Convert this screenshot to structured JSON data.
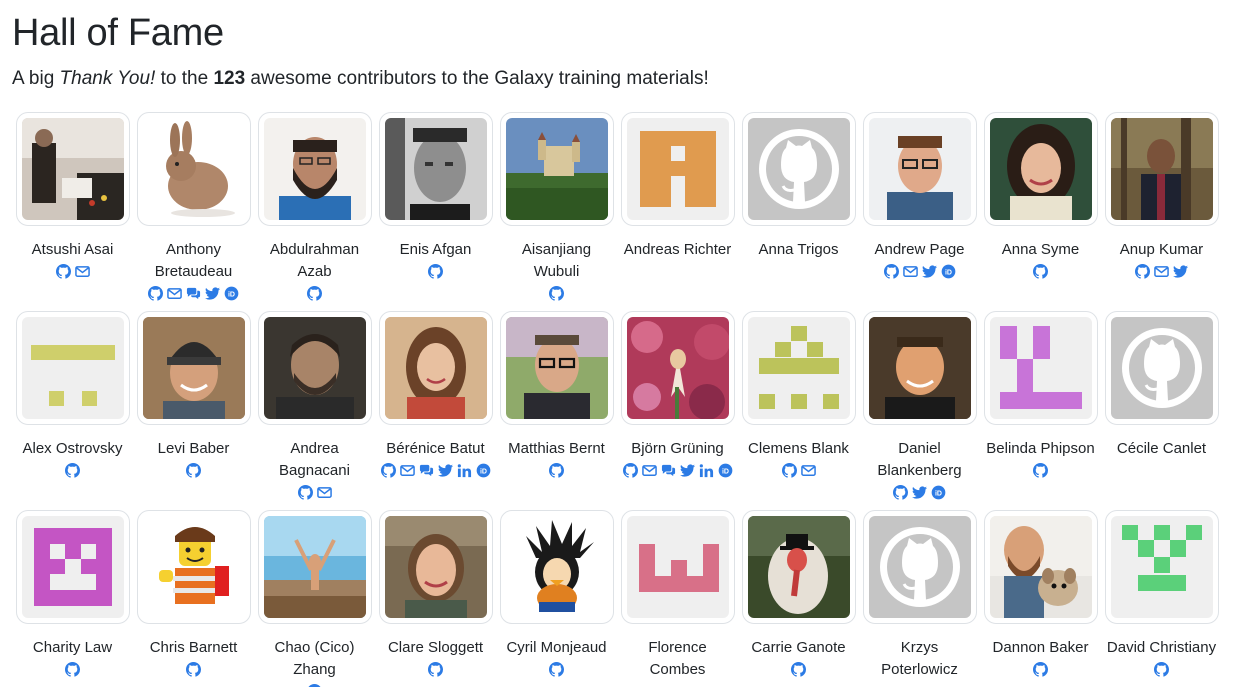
{
  "page": {
    "title": "Hall of Fame",
    "intro_prefix": "A big ",
    "intro_em": "Thank You!",
    "intro_mid": " to the ",
    "intro_count": "123",
    "intro_suffix": " awesome contributors to the Galaxy training materials!"
  },
  "colors": {
    "link": "#2c7be5",
    "text": "#212529",
    "border": "#dee2e6"
  },
  "contributors": [
    [
      {
        "name": "Atsushi Asai",
        "avatar": "photo-lab",
        "links": [
          "github",
          "email"
        ]
      },
      {
        "name": "Anthony Bretaudeau",
        "avatar": "photo-rabbit",
        "links": [
          "github",
          "email",
          "chat",
          "twitter",
          "orcid"
        ]
      },
      {
        "name": "Abdulrahman Azab",
        "avatar": "photo-beard",
        "links": [
          "github"
        ]
      },
      {
        "name": "Enis Afgan",
        "avatar": "photo-bw",
        "links": [
          "github"
        ]
      },
      {
        "name": "Aisanjiang Wubuli",
        "avatar": "photo-castle",
        "links": [
          "github"
        ]
      },
      {
        "name": "Andreas Richter",
        "avatar": "identicon-orange",
        "links": []
      },
      {
        "name": "Anna Trigos",
        "avatar": "github-default",
        "links": []
      },
      {
        "name": "Andrew Page",
        "avatar": "photo-glasses",
        "links": [
          "github",
          "email",
          "twitter",
          "orcid"
        ]
      },
      {
        "name": "Anna Syme",
        "avatar": "photo-woman",
        "links": [
          "github"
        ]
      },
      {
        "name": "Anup Kumar",
        "avatar": "photo-forest",
        "links": [
          "github",
          "email",
          "twitter"
        ]
      }
    ],
    [
      {
        "name": "Alex Ostrovsky",
        "avatar": "identicon-olive",
        "links": [
          "github"
        ]
      },
      {
        "name": "Levi Baber",
        "avatar": "photo-beanie",
        "links": [
          "github"
        ]
      },
      {
        "name": "Andrea Bagnacani",
        "avatar": "photo-dark",
        "links": [
          "github",
          "email"
        ]
      },
      {
        "name": "Bérénice Batut",
        "avatar": "photo-smile",
        "links": [
          "github",
          "email",
          "chat",
          "twitter",
          "linkedin",
          "orcid"
        ]
      },
      {
        "name": "Matthias Bernt",
        "avatar": "photo-outdoor",
        "links": [
          "github"
        ]
      },
      {
        "name": "Björn Grüning",
        "avatar": "photo-orchid",
        "links": [
          "github",
          "email",
          "chat",
          "twitter",
          "linkedin",
          "orcid"
        ]
      },
      {
        "name": "Clemens Blank",
        "avatar": "identicon-olive2",
        "links": [
          "github",
          "email"
        ]
      },
      {
        "name": "Daniel Blankenberg",
        "avatar": "photo-daniel",
        "links": [
          "github",
          "twitter",
          "orcid"
        ]
      },
      {
        "name": "Belinda Phipson",
        "avatar": "identicon-purple",
        "links": [
          "github"
        ]
      },
      {
        "name": "Cécile Canlet",
        "avatar": "github-default",
        "links": []
      }
    ],
    [
      {
        "name": "Charity Law",
        "avatar": "identicon-magenta",
        "links": [
          "github"
        ]
      },
      {
        "name": "Chris Barnett",
        "avatar": "photo-lego",
        "links": [
          "github"
        ]
      },
      {
        "name": "Chao (Cico) Zhang",
        "avatar": "photo-beach",
        "links": [
          "github"
        ]
      },
      {
        "name": "Clare Sloggett",
        "avatar": "photo-clare",
        "links": [
          "github"
        ]
      },
      {
        "name": "Cyril Monjeaud",
        "avatar": "photo-cartoon",
        "links": [
          "github"
        ]
      },
      {
        "name": "Florence Combes",
        "avatar": "identicon-pink",
        "links": []
      },
      {
        "name": "Carrie Ganote",
        "avatar": "photo-turkey",
        "links": [
          "github"
        ]
      },
      {
        "name": "Krzys Poterlowicz",
        "avatar": "github-default",
        "links": []
      },
      {
        "name": "Dannon Baker",
        "avatar": "photo-dog",
        "links": [
          "github"
        ]
      },
      {
        "name": "David Christiany",
        "avatar": "identicon-green",
        "links": [
          "github"
        ]
      }
    ]
  ]
}
